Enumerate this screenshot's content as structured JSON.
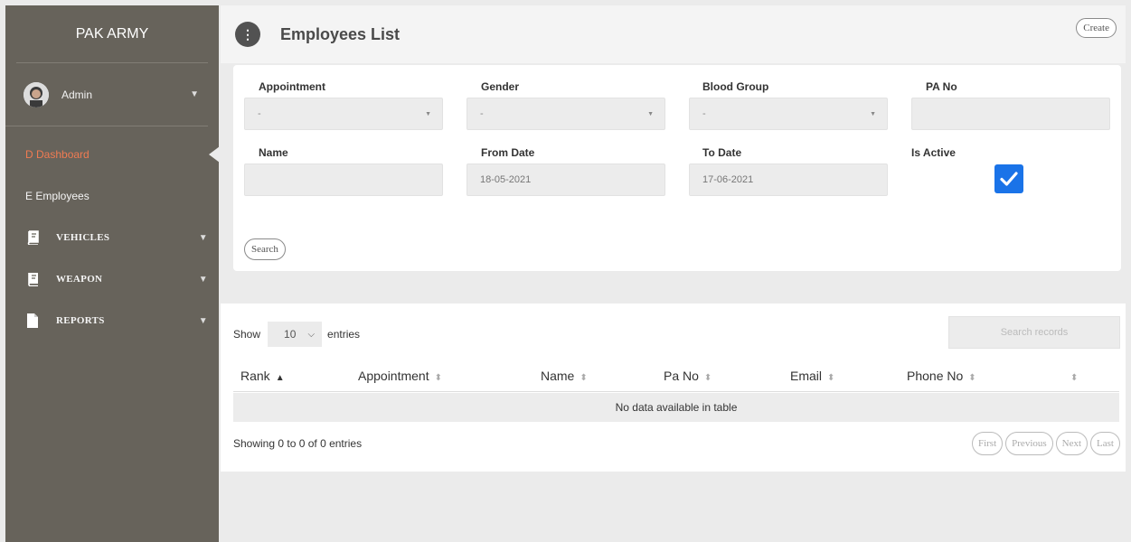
{
  "sidebar": {
    "brand": "PAK ARMY",
    "user": {
      "name": "Admin",
      "avatar_icon": "avatar-photo"
    },
    "items": [
      {
        "label": "D Dashboard",
        "active": true
      },
      {
        "label": "E Employees",
        "active": false
      },
      {
        "label": "VEHICLES",
        "icon": "book-icon",
        "expandable": true
      },
      {
        "label": "WEAPON",
        "icon": "book-icon",
        "expandable": true
      },
      {
        "label": "REPORTS",
        "icon": "file-icon",
        "expandable": true
      }
    ]
  },
  "header": {
    "icon_glyph": "⋮",
    "title": "Employees List",
    "create_label": "Create"
  },
  "filters": {
    "appointment": {
      "label": "Appointment",
      "value": "-"
    },
    "gender": {
      "label": "Gender",
      "value": "-"
    },
    "blood_group": {
      "label": "Blood Group",
      "value": "-"
    },
    "pa_no": {
      "label": "PA No",
      "value": ""
    },
    "name": {
      "label": "Name",
      "value": ""
    },
    "from_date": {
      "label": "From Date",
      "value": "18-05-2021"
    },
    "to_date": {
      "label": "To Date",
      "value": "17-06-2021"
    },
    "is_active": {
      "label": "Is Active",
      "checked": true
    },
    "search_label": "Search"
  },
  "table": {
    "show_label": "Show",
    "page_length": "10",
    "entries_label": "entries",
    "search_placeholder": "Search records",
    "columns": [
      "Rank",
      "Appointment",
      "Name",
      "Pa No",
      "Email",
      "Phone No",
      ""
    ],
    "empty_message": "No data available in table",
    "info": "Showing 0 to 0 of 0 entries",
    "pager": [
      "First",
      "Previous",
      "Next",
      "Last"
    ]
  },
  "colors": {
    "sidebar_bg": "#67635b",
    "active_nav": "#f07b52",
    "checkbox": "#1a73e8"
  }
}
